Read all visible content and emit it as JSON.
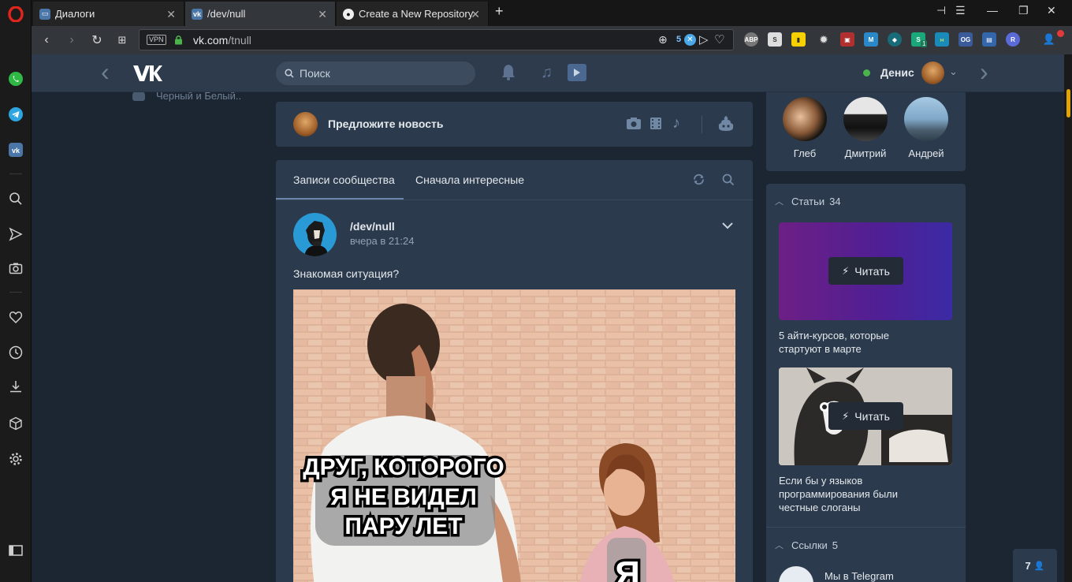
{
  "tabs": [
    {
      "label": "Диалоги"
    },
    {
      "label": "/dev/null"
    },
    {
      "label": "Create a New Repository"
    }
  ],
  "address": {
    "domain": "vk.com",
    "path": "/tnull",
    "vpn": "VPN",
    "badge_count": "5"
  },
  "extensions": [
    "ABP",
    "S",
    "M",
    "S",
    "OG",
    "R"
  ],
  "extension_badge": "1",
  "vk": {
    "search_placeholder": "Поиск",
    "user_name": "Денис",
    "left_menu_item": "Черный и Белый..",
    "suggest_news": "Предложите новость",
    "feed_tabs": [
      "Записи сообщества",
      "Сначала интересные"
    ],
    "post": {
      "author": "/dev/null",
      "time": "вчера в 21:24",
      "text": "Знакомая ситуация?",
      "meme_caption_lines": [
        "ДРУГ, КОТОРОГО",
        "Я НЕ ВИДЕЛ",
        "ПАРУ ЛЕТ"
      ],
      "meme_caption_me": "Я"
    },
    "friends": [
      {
        "name": "Глеб"
      },
      {
        "name": "Дмитрий"
      },
      {
        "name": "Андрей"
      }
    ],
    "articles_title": "Статьи",
    "articles_count": "34",
    "articles": [
      {
        "title": "5 айти-курсов, которые стартуют в марте",
        "button": "Читать"
      },
      {
        "title": "Если бы у языков программирования были честные слоганы",
        "button": "Читать"
      }
    ],
    "links_title": "Ссылки",
    "links_count": "5",
    "links": [
      {
        "title": "Мы в Telegram"
      }
    ],
    "online_count": "7"
  },
  "colors": {
    "vk_header": "#2d3b4d",
    "vk_bg": "#1c2633",
    "vk_card": "#2b3a4c",
    "opera_red": "#e0261b",
    "online_green": "#4bb34b"
  }
}
